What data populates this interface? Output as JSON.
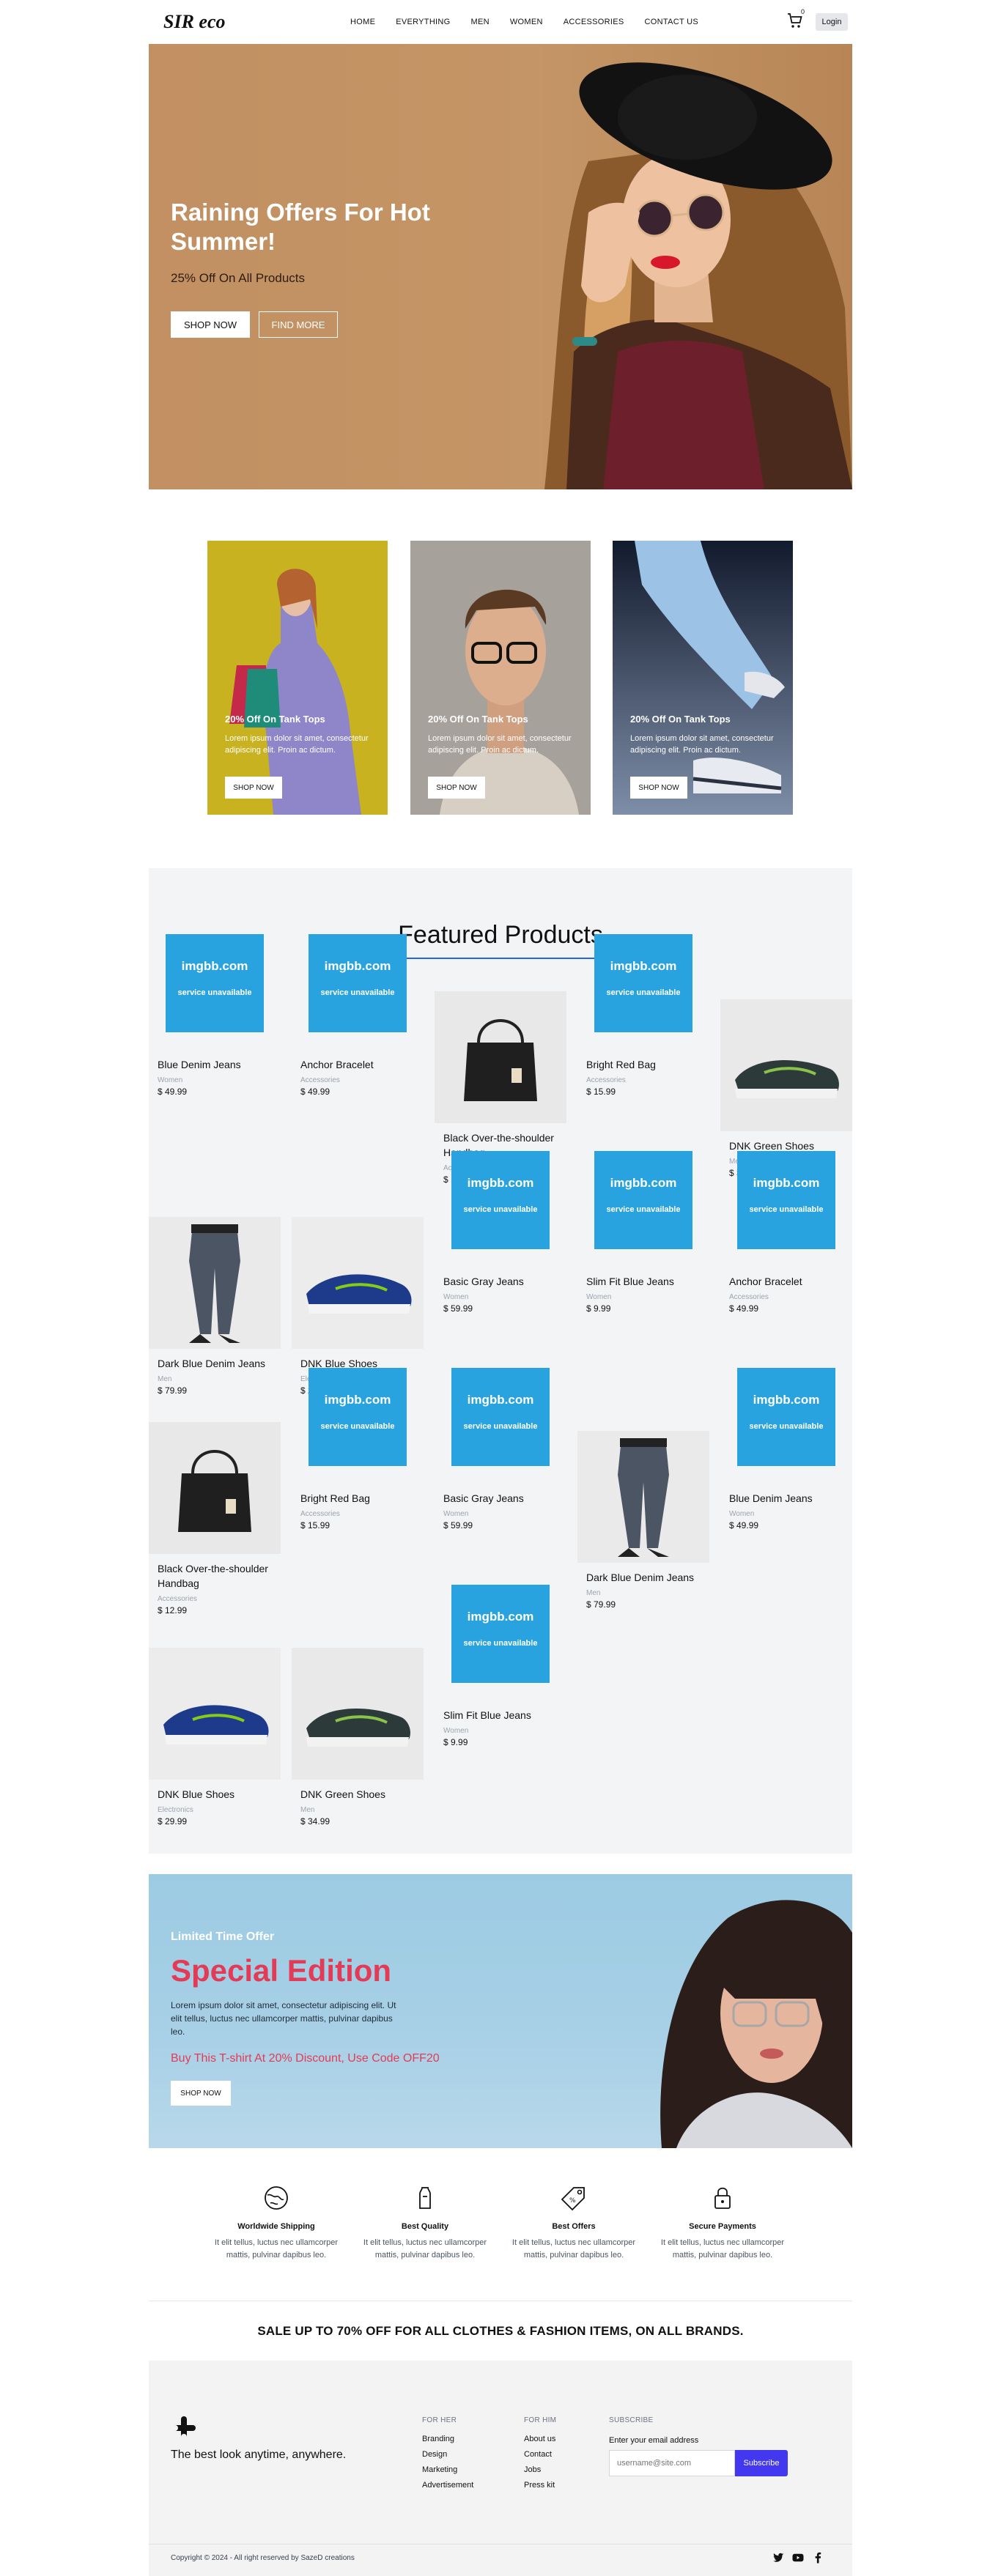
{
  "header": {
    "logo": "SIR eco",
    "nav": [
      "HOME",
      "EVERYTHING",
      "MEN",
      "WOMEN",
      "ACCESSORIES",
      "CONTACT US"
    ],
    "cart_count": "0",
    "login_label": "Login"
  },
  "hero": {
    "title": "Raining Offers For Hot Summer!",
    "subtitle": "25% Off On All Products",
    "shop_label": "SHOP NOW",
    "find_label": "FIND MORE"
  },
  "promos": [
    {
      "title": "20% Off On Tank Tops",
      "text": "Lorem ipsum dolor sit amet, consectetur adipiscing elit. Proin ac dictum.",
      "button": "SHOP NOW"
    },
    {
      "title": "20% Off On Tank Tops",
      "text": "Lorem ipsum dolor sit amet, consectetur adipiscing elit. Proin ac dictum.",
      "button": "SHOP NOW"
    },
    {
      "title": "20% Off On Tank Tops",
      "text": "Lorem ipsum dolor sit amet, consectetur adipiscing elit. Proin ac dictum.",
      "button": "SHOP NOW"
    }
  ],
  "featured": {
    "title": "Featured Products",
    "placeholder_title": "imgbb.com",
    "placeholder_sub": "service unavailable",
    "products": [
      {
        "name": "Blue Denim Jeans",
        "category": "Women",
        "price": "$ 49.99",
        "image": "placeholder"
      },
      {
        "name": "Anchor Bracelet",
        "category": "Accessories",
        "price": "$ 49.99",
        "image": "placeholder"
      },
      {
        "name": "Black Over-the-shoulder Handbag",
        "category": "Accessories",
        "price": "$ 12.99",
        "image": "handbag"
      },
      {
        "name": "Bright Red Bag",
        "category": "Accessories",
        "price": "$ 15.99",
        "image": "placeholder"
      },
      {
        "name": "DNK Green Shoes",
        "category": "Men",
        "price": "$ 34.99",
        "image": "green-shoes"
      },
      {
        "name": "Dark Blue Denim Jeans",
        "category": "Men",
        "price": "$ 79.99",
        "image": "jeans"
      },
      {
        "name": "DNK Blue Shoes",
        "category": "Electronics",
        "price": "$ 29.99",
        "image": "blue-shoes"
      },
      {
        "name": "Basic Gray Jeans",
        "category": "Women",
        "price": "$ 59.99",
        "image": "placeholder"
      },
      {
        "name": "Slim Fit Blue Jeans",
        "category": "Women",
        "price": "$ 9.99",
        "image": "placeholder"
      },
      {
        "name": "Anchor Bracelet",
        "category": "Accessories",
        "price": "$ 49.99",
        "image": "placeholder"
      },
      {
        "name": "Black Over-the-shoulder Handbag",
        "category": "Accessories",
        "price": "$ 12.99",
        "image": "handbag"
      },
      {
        "name": "Bright Red Bag",
        "category": "Accessories",
        "price": "$ 15.99",
        "image": "placeholder"
      },
      {
        "name": "Basic Gray Jeans",
        "category": "Women",
        "price": "$ 59.99",
        "image": "placeholder"
      },
      {
        "name": "Dark Blue Denim Jeans",
        "category": "Men",
        "price": "$ 79.99",
        "image": "jeans"
      },
      {
        "name": "Blue Denim Jeans",
        "category": "Women",
        "price": "$ 49.99",
        "image": "placeholder"
      },
      {
        "name": "DNK Blue Shoes",
        "category": "Electronics",
        "price": "$ 29.99",
        "image": "blue-shoes"
      },
      {
        "name": "DNK Green Shoes",
        "category": "Men",
        "price": "$ 34.99",
        "image": "green-shoes"
      },
      {
        "name": "Slim Fit Blue Jeans",
        "category": "Women",
        "price": "$ 9.99",
        "image": "placeholder"
      }
    ]
  },
  "special": {
    "tag": "Limited Time Offer",
    "title": "Special Edition",
    "text": "Lorem ipsum dolor sit amet, consectetur adipiscing elit. Ut elit tellus, luctus nec ullamcorper mattis, pulvinar dapibus leo.",
    "code": "Buy This T-shirt At 20% Discount, Use Code OFF20",
    "button": "SHOP NOW"
  },
  "features": [
    {
      "icon": "globe-icon",
      "name": "Worldwide Shipping",
      "desc": "It elit tellus, luctus nec ullamcorper mattis, pulvinar dapibus leo."
    },
    {
      "icon": "shirt-icon",
      "name": "Best Quality",
      "desc": "It elit tellus, luctus nec ullamcorper mattis, pulvinar dapibus leo."
    },
    {
      "icon": "tag-icon",
      "name": "Best Offers",
      "desc": "It elit tellus, luctus nec ullamcorper mattis, pulvinar dapibus leo."
    },
    {
      "icon": "lock-icon",
      "name": "Secure Payments",
      "desc": "It elit tellus, luctus nec ullamcorper mattis, pulvinar dapibus leo."
    }
  ],
  "sale_banner": "SALE UP TO 70% OFF FOR ALL CLOTHES & FASHION ITEMS, ON ALL BRANDS.",
  "footer": {
    "tagline": "The best look anytime, anywhere.",
    "for_her": {
      "heading": "FOR HER",
      "items": [
        "Branding",
        "Design",
        "Marketing",
        "Advertisement"
      ]
    },
    "for_him": {
      "heading": "FOR HIM",
      "items": [
        "About us",
        "Contact",
        "Jobs",
        "Press kit"
      ]
    },
    "subscribe": {
      "heading": "SUBSCRIBE",
      "label": "Enter your email address",
      "placeholder": "username@site.com",
      "button": "Subscribe"
    },
    "copyright": "Copyright © 2024 - All right reserved by SazeD creations"
  },
  "colors": {
    "accent": "#e33b55",
    "primary": "#4338f0",
    "placeholder": "#29a3e0",
    "hero_bg": "#c39364"
  }
}
